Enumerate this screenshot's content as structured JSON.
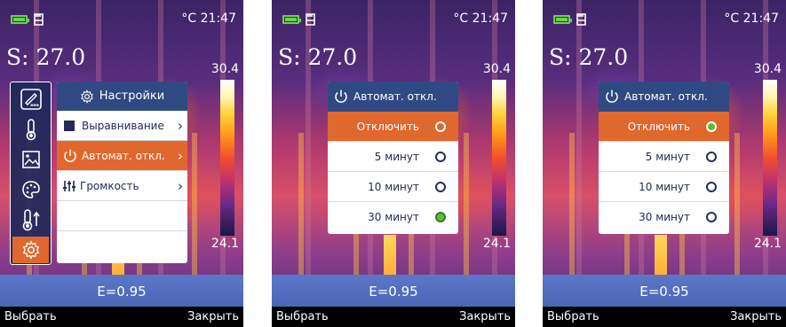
{
  "status": {
    "time": "°C 21:47"
  },
  "measure": {
    "spot": "S: 27.0",
    "scale_max": "30.4",
    "scale_min": "24.1",
    "emissivity": "E=0.95"
  },
  "softkeys": {
    "left": "Выбрать",
    "right": "Закрыть"
  },
  "toolbar_icons": [
    "ruler-icon",
    "thermometer-icon",
    "image-icon",
    "palette-icon",
    "temp-alarm-icon",
    "gear-icon"
  ],
  "settings_menu": {
    "title": "Настройки",
    "items": [
      {
        "label": "Выравнивание",
        "icon": "square-icon",
        "active": false
      },
      {
        "label": "Автомат. откл.",
        "icon": "power-icon",
        "active": true
      },
      {
        "label": "Громкость",
        "icon": "sliders-icon",
        "active": false
      }
    ]
  },
  "auto_off_dialog": {
    "title": "Автомат. откл.",
    "options": [
      "Отключить",
      "5 минут",
      "10 минут",
      "30 минут"
    ]
  },
  "screens": [
    {
      "view": "settings-menu"
    },
    {
      "view": "auto-off-dialog",
      "highlighted": "Отключить",
      "selected": "30 минут"
    },
    {
      "view": "auto-off-dialog",
      "highlighted": "Отключить",
      "selected": "Отключить"
    }
  ],
  "colors": {
    "accent": "#e0672e",
    "header": "#2f4a82",
    "radio_on": "#5cc02e",
    "battery": "#6bd24a",
    "emissivity_band": "#5b77c9"
  }
}
